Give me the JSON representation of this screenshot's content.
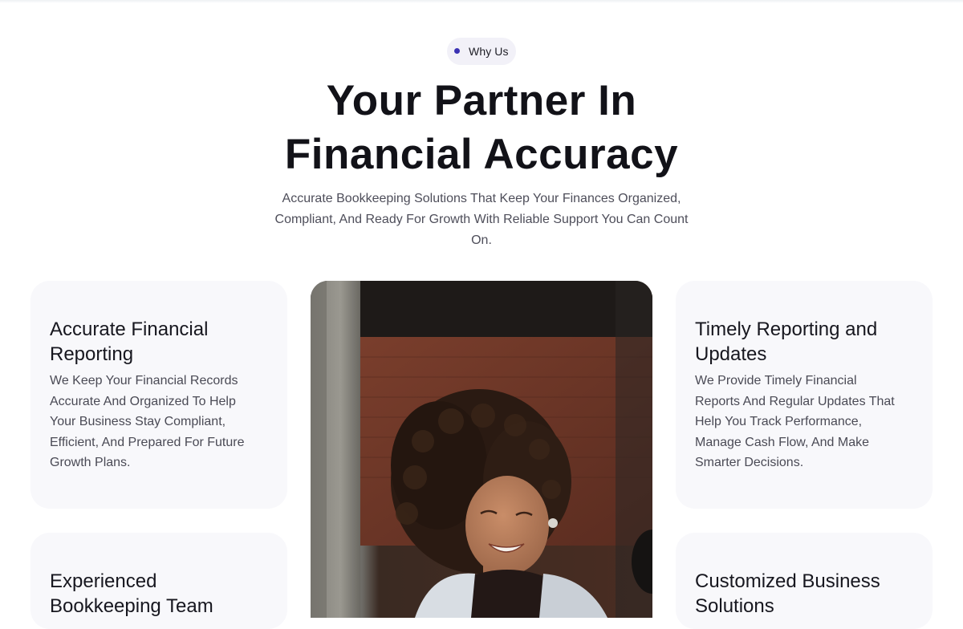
{
  "section": {
    "badge_label": "Why Us",
    "heading_line1": "Your Partner In",
    "heading_line2": "Financial Accuracy",
    "subtitle_line1": "Accurate Bookkeeping Solutions That Keep Your Finances Organized,",
    "subtitle_line2": "Compliant, And Ready For Growth With Reliable Support You Can Count",
    "subtitle_line3": "On."
  },
  "cards": {
    "top_left": {
      "title_line1": "Accurate Financial",
      "title_line2": "Reporting",
      "text_lines": [
        "We Keep Your Financial Records",
        "Accurate And Organized To Help",
        "Your Business Stay Compliant,",
        "Efficient, And Prepared For Future",
        "Growth Plans."
      ]
    },
    "top_right": {
      "title_line1": "Timely Reporting and",
      "title_line2": "Updates",
      "text_lines": [
        "We Provide Timely Financial",
        "Reports And Regular Updates That",
        "Help You Track Performance,",
        "Manage Cash Flow, And Make",
        "Smarter Decisions."
      ]
    },
    "bottom_left": {
      "title_line1": "Experienced",
      "title_line2": "Bookkeeping Team"
    },
    "bottom_right": {
      "title_line1": "Customized Business",
      "title_line2": "Solutions"
    }
  },
  "photo": {
    "icon": "smiling-woman-photo"
  },
  "colors": {
    "accent_dot": "#3b32b3",
    "badge_bg": "#f2f1f8",
    "card_bg": "#f8f8fb"
  }
}
